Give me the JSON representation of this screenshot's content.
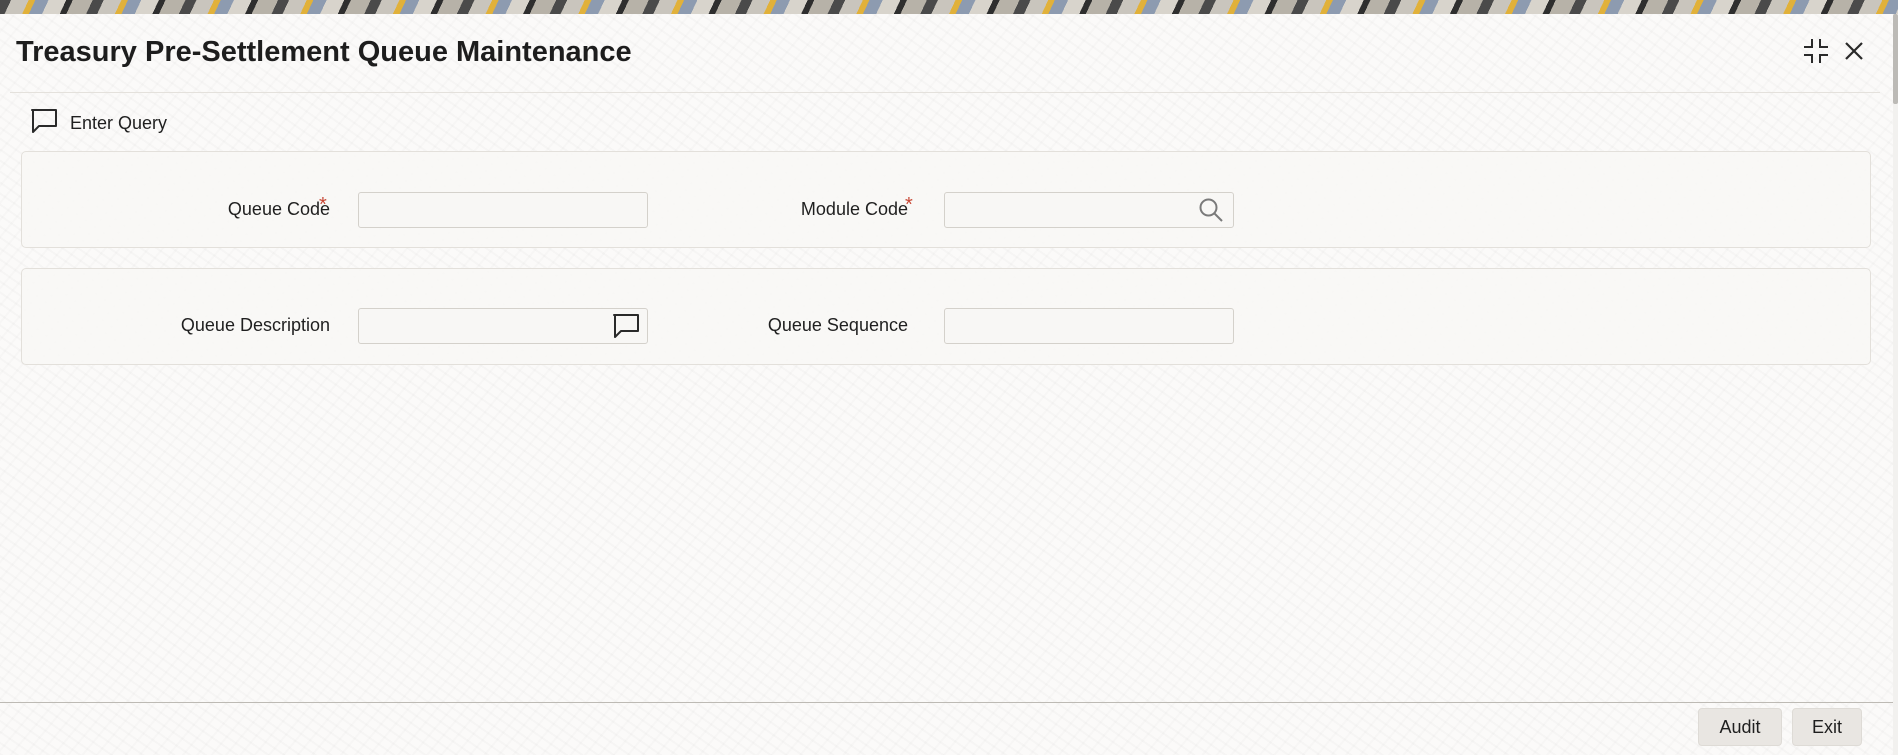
{
  "window": {
    "title": "Treasury Pre-Settlement Queue Maintenance"
  },
  "toolbar": {
    "enter_query_label": "Enter Query",
    "enter_query_icon": "chat-bubble-icon"
  },
  "form": {
    "queue_code": {
      "label": "Queue Code",
      "required_marker": "*",
      "value": ""
    },
    "module_code": {
      "label": "Module Code",
      "required_marker": "*",
      "value": "",
      "icon": "search-icon"
    },
    "queue_description": {
      "label": "Queue Description",
      "value": "",
      "icon": "chat-bubble-icon"
    },
    "queue_sequence": {
      "label": "Queue Sequence",
      "value": ""
    }
  },
  "footer": {
    "audit_label": "Audit",
    "exit_label": "Exit"
  },
  "colors": {
    "required": "#c74634",
    "panel_border": "#e3e0db",
    "button_bg": "#e9e6e2"
  }
}
